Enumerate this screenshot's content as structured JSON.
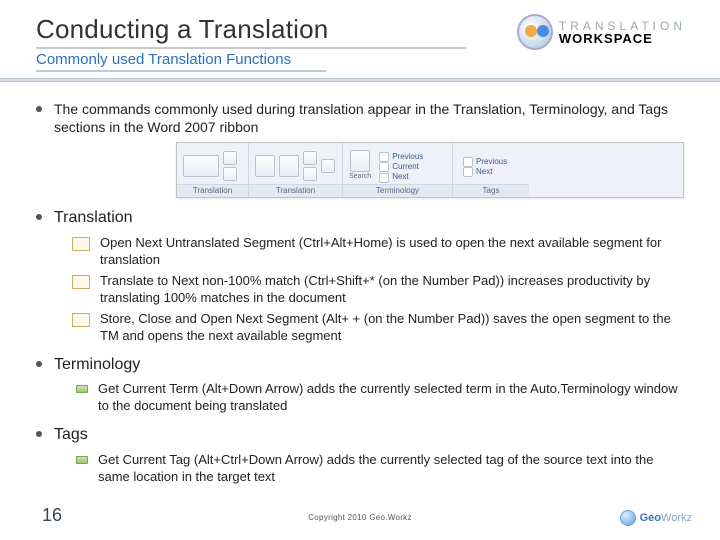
{
  "header": {
    "title": "Conducting a Translation",
    "subtitle": "Commonly used Translation Functions",
    "logo_line1": "TRANSLATION",
    "logo_line2": "WORKSPACE"
  },
  "ribbon": {
    "groups": [
      {
        "label": "Translation"
      },
      {
        "label": "Translation"
      },
      {
        "label": "Terminology"
      },
      {
        "label": "Tags"
      }
    ],
    "linkcols": [
      {
        "items": [
          "Previous",
          "Current",
          "Next"
        ]
      },
      {
        "items": [
          "Previous",
          "Next"
        ]
      }
    ],
    "search_label": "Search"
  },
  "bullets": {
    "intro": "The commands commonly used during translation appear in the Translation, Terminology, and Tags sections in the Word 2007 ribbon",
    "sections": [
      {
        "title": "Translation",
        "icon": "small",
        "items": [
          {
            "text": "Open Next Untranslated Segment (Ctrl+Alt+Home) is used to open the next available segment for translation"
          },
          {
            "text": "Translate to Next non-100% match (Ctrl+Shift+* (on the Number Pad)) increases productivity by translating 100% matches in the document"
          },
          {
            "text": "Store, Close and Open Next Segment (Alt+ + (on the Number Pad)) saves the open segment to the TM and opens the next available segment"
          }
        ]
      },
      {
        "title": "Terminology",
        "icon": "dash",
        "items": [
          {
            "text": "Get Current Term (Alt+Down Arrow) adds the currently selected term in the Auto.Terminology window to the document being translated"
          }
        ]
      },
      {
        "title": "Tags",
        "icon": "dash",
        "items": [
          {
            "text": "Get Current Tag (Alt+Ctrl+Down Arrow) adds the currently selected tag of the source text into the same location in the target text"
          }
        ]
      }
    ]
  },
  "footer": {
    "page": "16",
    "copyright": "Copyright 2010 Geo.Workz",
    "brand_geo": "Geo",
    "brand_workz": "Workz"
  }
}
